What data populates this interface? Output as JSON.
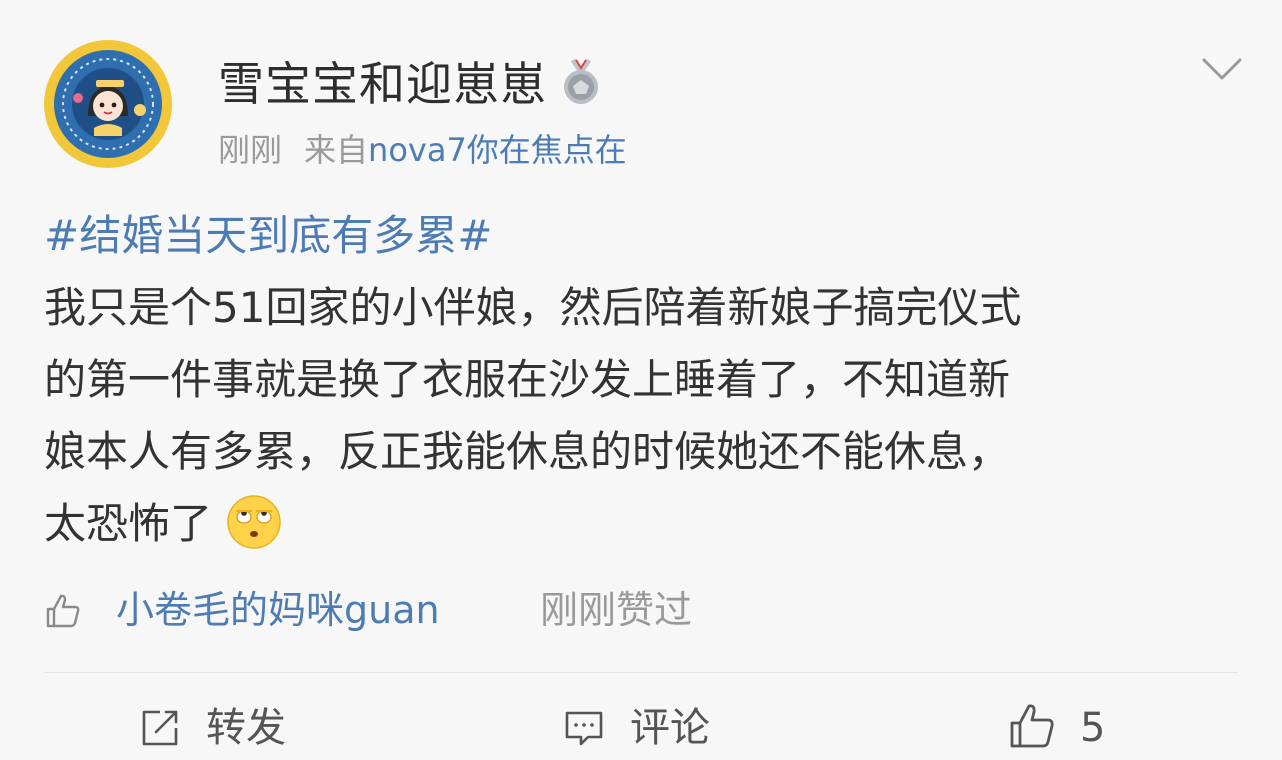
{
  "post": {
    "author": {
      "name": "雪宝宝和迎崽崽",
      "avatar_icon": "avatar-badge-icon",
      "badge_icon": "medal-icon"
    },
    "meta": {
      "time": "刚刚",
      "source_prefix": "来自",
      "source": "nova7你在焦点在"
    },
    "content": {
      "hashtag": "#结婚当天到底有多累#",
      "lines": [
        "我只是个51回家的小伴娘，然后陪着新娘子搞完仪式",
        "的第一件事就是换了衣服在沙发上睡着了，不知道新",
        "娘本人有多累，反正我能休息的时候她还不能休息，",
        "太恐怖了"
      ],
      "emoji": "eye-roll-emoji-icon"
    },
    "liked_by": {
      "name": "小卷毛的妈咪guan",
      "text": "刚刚赞过"
    }
  },
  "actions": {
    "repost_label": "转发",
    "comment_label": "评论",
    "like_count": "5"
  },
  "colors": {
    "link": "#4d7cb5",
    "muted": "#9a9a9a",
    "text": "#333333",
    "background": "#f7f7f7"
  }
}
